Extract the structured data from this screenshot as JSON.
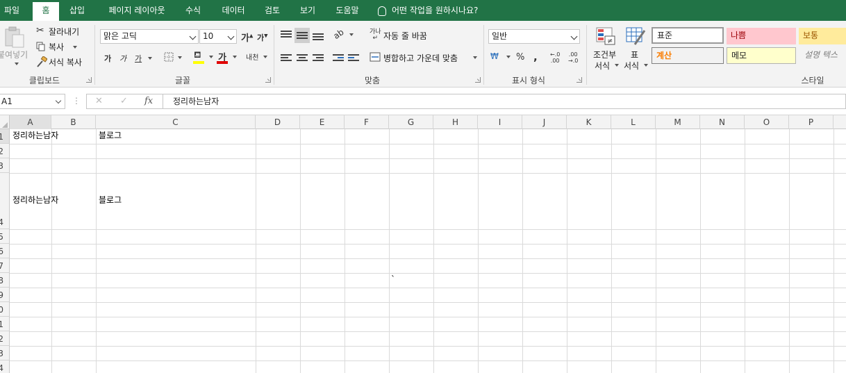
{
  "tabs": [
    "파일",
    "홈",
    "삽입",
    "페이지 레이아웃",
    "수식",
    "데이터",
    "검토",
    "보기",
    "도움말"
  ],
  "active_tab": "홈",
  "tell_me": "어떤 작업을 원하시나요?",
  "ribbon": {
    "clipboard": {
      "paste": "붙여넣기",
      "cut": "잘라내기",
      "copy": "복사",
      "format_painter": "서식 복사",
      "group_label": "클립보드"
    },
    "font": {
      "font_name": "맑은 고딕",
      "font_size": "10",
      "grow": "가",
      "shrink": "가",
      "bold": "가",
      "italic": "가",
      "underline": "가",
      "font_color_glyph": "가",
      "phonetic": "내천",
      "group_label": "글꼴"
    },
    "alignment": {
      "wrap_text": "자동 줄 바꿈",
      "merge_center": "병합하고 가운데 맞춤",
      "group_label": "맞춤"
    },
    "number": {
      "format": "일반",
      "percent": "%",
      "comma": ",",
      "group_label": "표시 형식"
    },
    "styles": {
      "conditional_line1": "조건부",
      "conditional_line2": "서식",
      "table_line1": "표",
      "table_line2": "서식",
      "normal": "표준",
      "bad": "나쁨",
      "neutral": "보통",
      "calculation": "계산",
      "note": "메모",
      "explanatory": "설명 텍스",
      "group_label": "스타일"
    }
  },
  "formula_bar": {
    "name_box": "A1",
    "cancel": "✕",
    "enter": "✓",
    "fx": "fx",
    "content": "정리하는남자"
  },
  "columns": [
    "A",
    "B",
    "C",
    "D",
    "E",
    "F",
    "G",
    "H",
    "I",
    "J",
    "K",
    "L",
    "M",
    "N",
    "O",
    "P"
  ],
  "row_labels": [
    "1",
    "2",
    "3",
    "4",
    "5",
    "6",
    "7",
    "8",
    "9",
    "0",
    "1",
    "2",
    "3",
    "4"
  ],
  "cells": {
    "a1": "정리하는남자",
    "c1": "블로그",
    "a4": "정리하는남자",
    "c4": "블로그",
    "g8": "`"
  },
  "colors": {
    "brand": "#217346",
    "bad_bg": "#ffc7ce",
    "bad_fg": "#9c0006",
    "neutral_bg": "#ffeb9c",
    "neutral_fg": "#9c5700",
    "calc_bg": "#f2f2f2",
    "calc_fg": "#fa7d00",
    "note_bg": "#ffffcc"
  }
}
